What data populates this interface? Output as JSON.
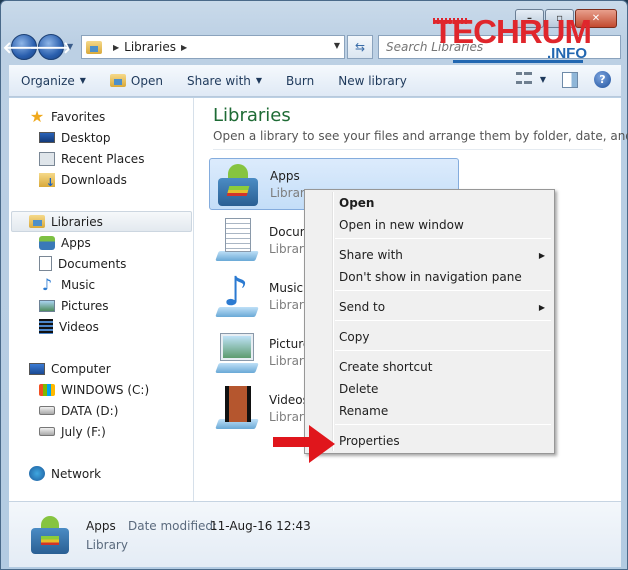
{
  "window": {
    "controls": {
      "minimize": "–",
      "maximize": "▫",
      "close": "✕"
    }
  },
  "watermark": {
    "main": "TECHRUM",
    "sub": ".INFO"
  },
  "nav": {
    "back_icon": "🡐",
    "forward_icon": "🡒",
    "address": {
      "crumbs": [
        "Libraries"
      ]
    },
    "search_placeholder": "Search Libraries"
  },
  "toolbar": {
    "items": [
      {
        "label": "Organize",
        "has_dropdown": true
      },
      {
        "label": "Open",
        "has_icon": true
      },
      {
        "label": "Share with",
        "has_dropdown": true
      },
      {
        "label": "Burn"
      },
      {
        "label": "New library"
      }
    ],
    "help_label": "?"
  },
  "sidebar": {
    "favorites": {
      "label": "Favorites",
      "items": [
        "Desktop",
        "Recent Places",
        "Downloads"
      ]
    },
    "libraries": {
      "label": "Libraries",
      "items": [
        "Apps",
        "Documents",
        "Music",
        "Pictures",
        "Videos"
      ]
    },
    "computer": {
      "label": "Computer",
      "items": [
        "WINDOWS (C:)",
        "DATA (D:)",
        "July (F:)"
      ]
    },
    "network": {
      "label": "Network"
    }
  },
  "main": {
    "title": "Libraries",
    "subtitle": "Open a library to see your files and arrange them by folder, date, and o...",
    "libraries": [
      {
        "name": "Apps",
        "type": "Library",
        "selected": true
      },
      {
        "name": "Docum",
        "type": "Library"
      },
      {
        "name": "Music",
        "type": "Library"
      },
      {
        "name": "Picture",
        "type": "Library"
      },
      {
        "name": "Videos",
        "type": "Library"
      }
    ]
  },
  "context_menu": {
    "items": [
      {
        "label": "Open",
        "bold": true
      },
      {
        "label": "Open in new window"
      },
      {
        "label": "Share with",
        "submenu": true
      },
      {
        "label": "Don't show in navigation pane"
      },
      {
        "label": "Send to",
        "submenu": true
      },
      {
        "label": "Copy"
      },
      {
        "label": "Create shortcut"
      },
      {
        "label": "Delete"
      },
      {
        "label": "Rename"
      },
      {
        "label": "Properties",
        "highlighted_by_arrow": true
      }
    ]
  },
  "details": {
    "name": "Apps",
    "date_label": "Date modified:",
    "date_value": "11-Aug-16 12:43",
    "type": "Library"
  },
  "colors": {
    "title_green": "#1e6b35",
    "arrow_red": "#e0161c",
    "selection_blue": "#c4def8"
  }
}
